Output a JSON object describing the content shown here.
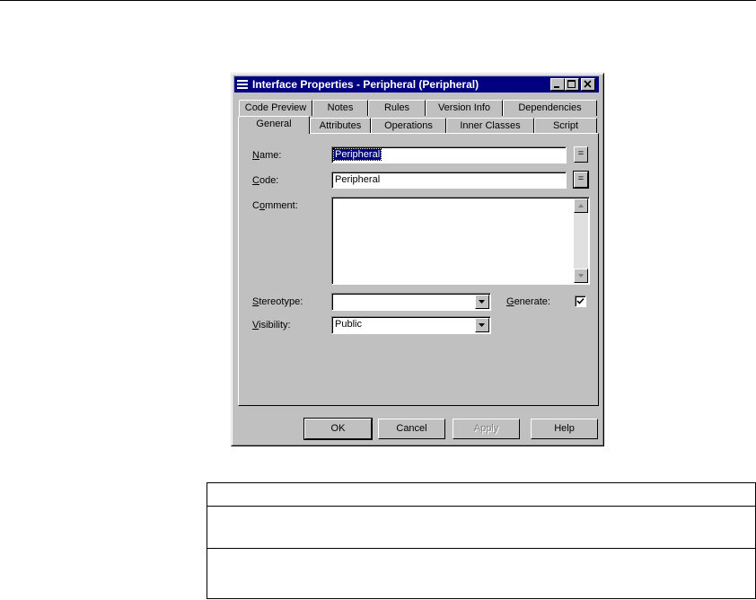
{
  "window": {
    "title": "Interface Properties - Peripheral (Peripheral)"
  },
  "tabs_back": [
    "Code Preview",
    "Notes",
    "Rules",
    "Version Info",
    "Dependencies"
  ],
  "tabs_front": [
    "General",
    "Attributes",
    "Operations",
    "Inner Classes",
    "Script"
  ],
  "active_tab": "General",
  "form": {
    "name_label": "Name:",
    "name_value": "Peripheral",
    "code_label": "Code:",
    "code_value": "Peripheral",
    "comment_label": "Comment:",
    "comment_value": "",
    "stereotype_label": "Stereotype:",
    "stereotype_value": "",
    "generate_label": "Generate:",
    "generate_checked": true,
    "visibility_label": "Visibility:",
    "visibility_value": "Public",
    "eq_button": "="
  },
  "buttons": {
    "ok": "OK",
    "cancel": "Cancel",
    "apply": "Apply",
    "help": "Help"
  },
  "colors": {
    "titlebar": "#000080",
    "face": "#c0c0c0"
  }
}
